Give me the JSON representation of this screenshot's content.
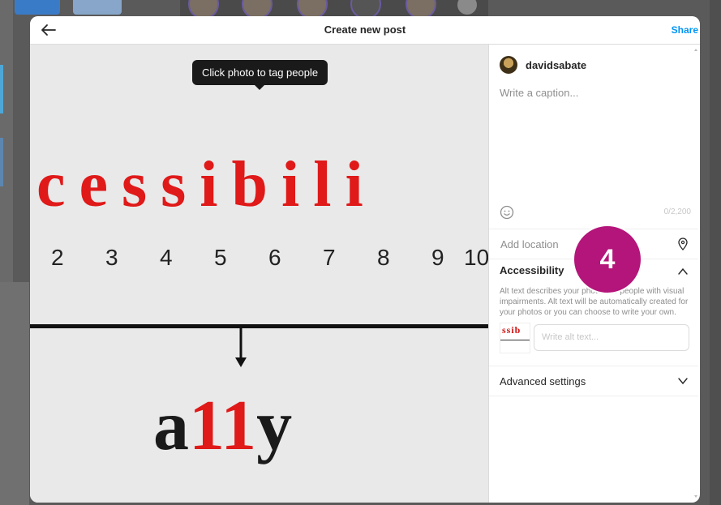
{
  "modal": {
    "title": "Create new post",
    "share_label": "Share",
    "back_icon": "arrow-left-icon"
  },
  "photo": {
    "tooltip": "Click photo to tag people",
    "word": "cessibili",
    "numbers": [
      "2",
      "3",
      "4",
      "5",
      "6",
      "7",
      "8",
      "9",
      "10"
    ],
    "ally_parts": [
      "a",
      "11",
      "y"
    ]
  },
  "sidebar": {
    "username": "davidsabate",
    "caption_placeholder": "Write a caption...",
    "char_count": "0/2,200",
    "location_placeholder": "Add location",
    "accessibility": {
      "title": "Accessibility",
      "description": "Alt text describes your photos for people with visual impairments. Alt text will be automatically created for your photos or you can choose to write your own.",
      "thumb_text": "ssib",
      "alt_placeholder": "Write alt text..."
    },
    "advanced_label": "Advanced settings"
  },
  "step_badge": "4",
  "colors": {
    "accent_blue": "#0095f6",
    "badge_magenta": "#b4157a",
    "photo_red": "#e01919"
  }
}
